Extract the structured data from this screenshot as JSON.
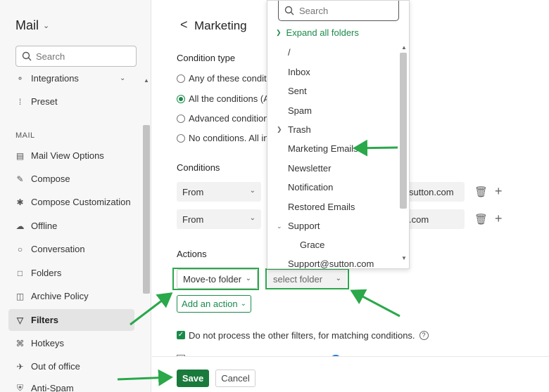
{
  "sidebar": {
    "title": "Mail",
    "search_placeholder": "Search",
    "section_mail": "MAIL",
    "items": [
      {
        "label": "Integrations",
        "icon": "plug-icon"
      },
      {
        "label": "Preset",
        "icon": "sliders-icon"
      },
      {
        "label": "Mail View Options",
        "icon": "layout-icon"
      },
      {
        "label": "Compose",
        "icon": "edit-icon"
      },
      {
        "label": "Compose Customization",
        "icon": "customize-icon"
      },
      {
        "label": "Offline",
        "icon": "cloud-off-icon"
      },
      {
        "label": "Conversation",
        "icon": "chat-icon"
      },
      {
        "label": "Folders",
        "icon": "folder-icon"
      },
      {
        "label": "Archive Policy",
        "icon": "archive-icon"
      },
      {
        "label": "Filters",
        "icon": "filter-icon"
      },
      {
        "label": "Hotkeys",
        "icon": "command-icon"
      },
      {
        "label": "Out of office",
        "icon": "plane-icon"
      },
      {
        "label": "Anti-Spam",
        "icon": "shield-icon"
      }
    ]
  },
  "header": {
    "back": "<",
    "title": "Marketing"
  },
  "condition_type": {
    "label": "Condition type",
    "options": [
      {
        "label": "Any of these conditio",
        "selected": false
      },
      {
        "label": "All the conditions (AN",
        "selected": true
      },
      {
        "label": "Advanced conditions",
        "selected": false
      },
      {
        "label": "No conditions. All inco",
        "selected": false
      }
    ]
  },
  "conditions": {
    "label": "Conditions",
    "rows": [
      {
        "field": "From",
        "value": "sutton.com"
      },
      {
        "field": "From",
        "value": ".com"
      }
    ]
  },
  "actions": {
    "label": "Actions",
    "action_select": "Move-to folder",
    "folder_select": "select folder",
    "add_action": "Add an action"
  },
  "options": {
    "do_not_process": "Do not process the other filters, for matching conditions.",
    "help": "?"
  },
  "footer": {
    "save": "Save",
    "cancel": "Cancel"
  },
  "folder_dropdown": {
    "search_placeholder": "Search",
    "expand_all": "Expand all folders",
    "folders": [
      {
        "label": "/",
        "arrow": ""
      },
      {
        "label": "Inbox",
        "arrow": ""
      },
      {
        "label": "Sent",
        "arrow": ""
      },
      {
        "label": "Spam",
        "arrow": ""
      },
      {
        "label": "Trash",
        "arrow": ">"
      },
      {
        "label": "Marketing Emails",
        "arrow": ""
      },
      {
        "label": "Newsletter",
        "arrow": ""
      },
      {
        "label": "Notification",
        "arrow": ""
      },
      {
        "label": "Restored Emails",
        "arrow": ""
      },
      {
        "label": "Support",
        "arrow": "v"
      },
      {
        "label": "Grace",
        "arrow": ""
      },
      {
        "label": "Support@sutton.com",
        "arrow": ""
      }
    ]
  },
  "colors": {
    "accent": "#1a8a4a",
    "highlight": "#2aa84a",
    "save_bg": "#1a7a3c"
  }
}
